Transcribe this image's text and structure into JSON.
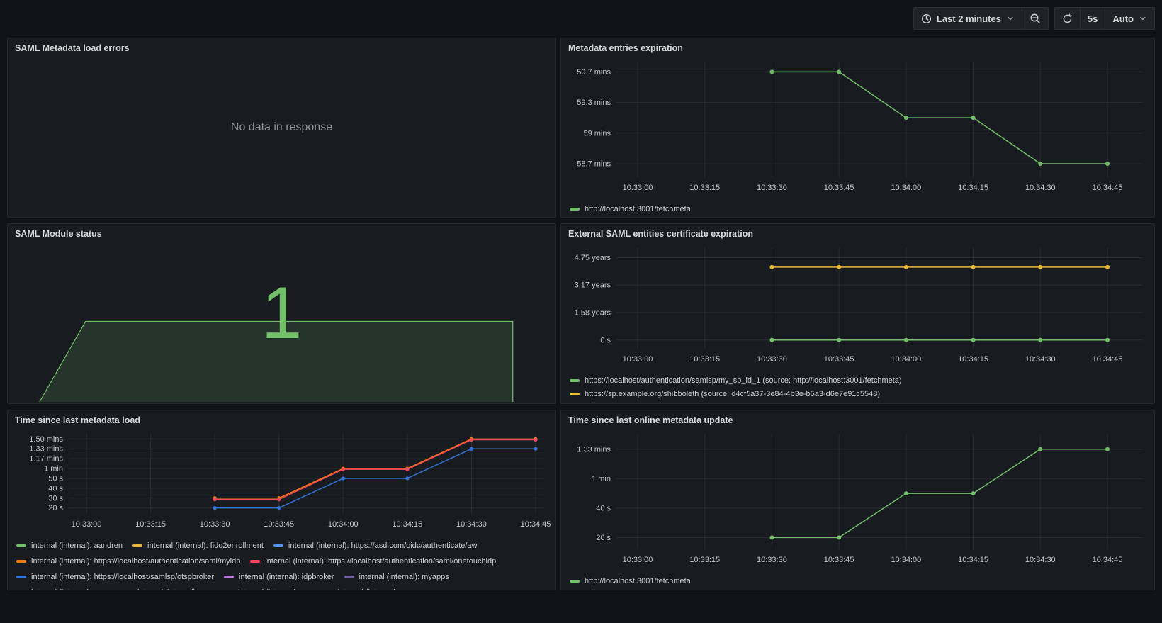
{
  "toolbar": {
    "time_range_label": "Last 2 minutes",
    "refresh_interval": "5s",
    "auto_label": "Auto",
    "icons": [
      "clock-icon",
      "chevron-down-icon",
      "zoom-out-icon",
      "refresh-icon"
    ]
  },
  "colors": {
    "background": "#111217",
    "panel": "#181b1f",
    "green": "#73bf69",
    "yellow": "#eab839",
    "orange": "#ff780a",
    "red": "#f2495c",
    "blue": "#3274d9",
    "light_blue": "#5794f2",
    "purple": "#b877d9",
    "dark_purple": "#705da0"
  },
  "panels": {
    "load_errors": {
      "title": "SAML Metadata load errors",
      "message": "No data in response"
    },
    "entries_expiration": {
      "title": "Metadata entries expiration",
      "chart_data": {
        "type": "line",
        "x": [
          "10:33:00",
          "10:33:15",
          "10:33:30",
          "10:33:45",
          "10:34:00",
          "10:34:15",
          "10:34:30",
          "10:34:45"
        ],
        "ylim": [
          58.52,
          59.77
        ],
        "yticks": [
          {
            "v": 59.667,
            "label": "59.7 mins"
          },
          {
            "v": 59.333,
            "label": "59.3 mins"
          },
          {
            "v": 59.0,
            "label": "59 mins"
          },
          {
            "v": 58.667,
            "label": "58.7 mins"
          }
        ],
        "series": [
          {
            "name": "http://localhost:3001/fetchmeta",
            "color": "#73bf69",
            "values": [
              null,
              null,
              59.667,
              59.667,
              59.167,
              59.167,
              58.667,
              58.667
            ]
          }
        ]
      }
    },
    "module_status": {
      "title": "SAML Module status",
      "value": "1",
      "sparkline": {
        "color": "#73bf69",
        "fill": "rgba(115,191,105,0.16)",
        "points_frac": [
          [
            0.058,
            1
          ],
          [
            0.142,
            0.5
          ],
          [
            0.922,
            0.5
          ],
          [
            0.922,
            1
          ]
        ]
      }
    },
    "cert_expiration": {
      "title": "External SAML entities certificate expiration",
      "chart_data": {
        "type": "line",
        "x": [
          "10:33:00",
          "10:33:15",
          "10:33:30",
          "10:33:45",
          "10:34:00",
          "10:34:15",
          "10:34:30",
          "10:34:45"
        ],
        "ylim": [
          -0.5,
          5.3
        ],
        "yticks": [
          {
            "v": 4.75,
            "label": "4.75 years"
          },
          {
            "v": 3.1667,
            "label": "3.17 years"
          },
          {
            "v": 1.5833,
            "label": "1.58 years"
          },
          {
            "v": 0,
            "label": "0 s"
          }
        ],
        "series": [
          {
            "name": "https://localhost/authentication/samlsp/my_sp_id_1 (source: http://localhost:3001/fetchmeta)",
            "color": "#73bf69",
            "values": [
              null,
              null,
              0,
              0,
              0,
              0,
              0,
              0
            ]
          },
          {
            "name": "https://sp.example.org/shibboleth (source: d4cf5a37-3e84-4b3e-b5a3-d6e7e91c5548)",
            "color": "#eab839",
            "values": [
              null,
              null,
              4.2,
              4.2,
              4.2,
              4.2,
              4.2,
              4.2
            ]
          }
        ]
      }
    },
    "time_since_load": {
      "title": "Time since last metadata load",
      "chart_data": {
        "type": "line",
        "x": [
          "10:33:00",
          "10:33:15",
          "10:33:30",
          "10:33:45",
          "10:34:00",
          "10:34:15",
          "10:34:30",
          "10:34:45"
        ],
        "ylim": [
          14,
          96
        ],
        "yticks": [
          {
            "v": 90,
            "label": "1.50 mins"
          },
          {
            "v": 80,
            "label": "1.33 mins"
          },
          {
            "v": 70,
            "label": "1.17 mins"
          },
          {
            "v": 60,
            "label": "1 min"
          },
          {
            "v": 50,
            "label": "50 s"
          },
          {
            "v": 40,
            "label": "40 s"
          },
          {
            "v": 30,
            "label": "30 s"
          },
          {
            "v": 20,
            "label": "20 s"
          }
        ],
        "series": [
          {
            "name": "internal (internal): aandren",
            "color": "#73bf69",
            "values": null
          },
          {
            "name": "internal (internal): fido2enrollment",
            "color": "#eab839",
            "values": null
          },
          {
            "name": "internal (internal): https://asd.com/oidc/authenticate/aw",
            "color": "#5794f2",
            "values": null
          },
          {
            "name": "internal (internal): https://localhost/authentication/saml/myidp",
            "color": "#ff780a",
            "values": [
              null,
              null,
              30,
              30,
              60,
              60,
              90,
              90
            ]
          },
          {
            "name": "internal (internal): https://localhost/authentication/saml/onetouchidp",
            "color": "#f2495c",
            "values": [
              null,
              null,
              28.6,
              28.6,
              59.2,
              59.2,
              89.2,
              89.2
            ]
          },
          {
            "name": "internal (internal): https://localhost/samlsp/otspbroker",
            "color": "#3274d9",
            "values": [
              null,
              null,
              20,
              20,
              50,
              50,
              80,
              80
            ]
          },
          {
            "name": "internal (internal): idpbroker",
            "color": "#b877d9",
            "values": null
          },
          {
            "name": "internal (internal): myapps",
            "color": "#705da0",
            "values": null
          },
          {
            "name": "internal (internal): mysp",
            "color": "#56a64b",
            "values": null
          },
          {
            "name": "internal (internal): ppe",
            "color": "#fade2a",
            "values": null
          },
          {
            "name": "internal (internal): pss",
            "color": "#5794f2",
            "values": null
          },
          {
            "name": "internal (internal): wwaw",
            "color": "#e0752d",
            "values": null
          }
        ]
      }
    },
    "time_since_update": {
      "title": "Time since last online metadata update",
      "chart_data": {
        "type": "line",
        "x": [
          "10:33:00",
          "10:33:15",
          "10:33:30",
          "10:33:45",
          "10:34:00",
          "10:34:15",
          "10:34:30",
          "10:34:45"
        ],
        "ylim": [
          12,
          90
        ],
        "yticks": [
          {
            "v": 80,
            "label": "1.33 mins"
          },
          {
            "v": 60,
            "label": "1 min"
          },
          {
            "v": 40,
            "label": "40 s"
          },
          {
            "v": 20,
            "label": "20 s"
          }
        ],
        "series": [
          {
            "name": "http://localhost:3001/fetchmeta",
            "color": "#73bf69",
            "values": [
              null,
              null,
              20,
              20,
              50,
              50,
              80,
              80
            ]
          }
        ]
      }
    }
  }
}
